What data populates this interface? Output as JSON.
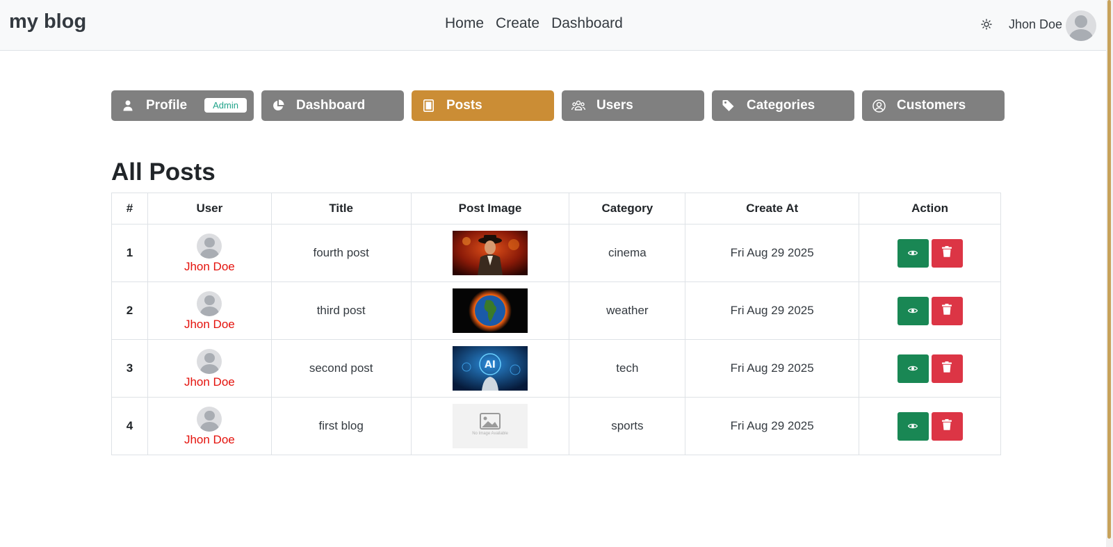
{
  "navbar": {
    "brand": "my blog",
    "links": [
      "Home",
      "Create",
      "Dashboard"
    ],
    "theme_icon": "sun-icon",
    "user_name": "Jhon Doe"
  },
  "tabs": [
    {
      "label": "Profile",
      "icon": "user-icon",
      "badge": "Admin",
      "active": false
    },
    {
      "label": "Dashboard",
      "icon": "pie-chart-icon",
      "active": false
    },
    {
      "label": "Posts",
      "icon": "document-icon",
      "active": true
    },
    {
      "label": "Users",
      "icon": "users-icon",
      "active": false
    },
    {
      "label": "Categories",
      "icon": "tag-icon",
      "active": false
    },
    {
      "label": "Customers",
      "icon": "user-circle-icon",
      "active": false
    }
  ],
  "page_title": "All Posts",
  "table": {
    "headers": [
      "#",
      "User",
      "Title",
      "Post Image",
      "Category",
      "Create At",
      "Action"
    ],
    "rows": [
      {
        "num": "1",
        "user": "Jhon Doe",
        "title": "fourth post",
        "image": "movie-poster-image",
        "category": "cinema",
        "created": "Fri Aug 29 2025"
      },
      {
        "num": "2",
        "user": "Jhon Doe",
        "title": "third post",
        "image": "burning-earth-image",
        "category": "weather",
        "created": "Fri Aug 29 2025"
      },
      {
        "num": "3",
        "user": "Jhon Doe",
        "title": "second post",
        "image": "ai-hand-image",
        "category": "tech",
        "created": "Fri Aug 29 2025"
      },
      {
        "num": "4",
        "user": "Jhon Doe",
        "title": "first blog",
        "image": "no-image-placeholder",
        "image_caption": "No Image Available",
        "category": "sports",
        "created": "Fri Aug 29 2025"
      }
    ]
  },
  "colors": {
    "active_tab": "#cb8d35",
    "tab": "#808080",
    "view_button": "#198754",
    "delete_button": "#dc3545",
    "user_link": "#e4120c",
    "badge_text": "#20a38a"
  }
}
